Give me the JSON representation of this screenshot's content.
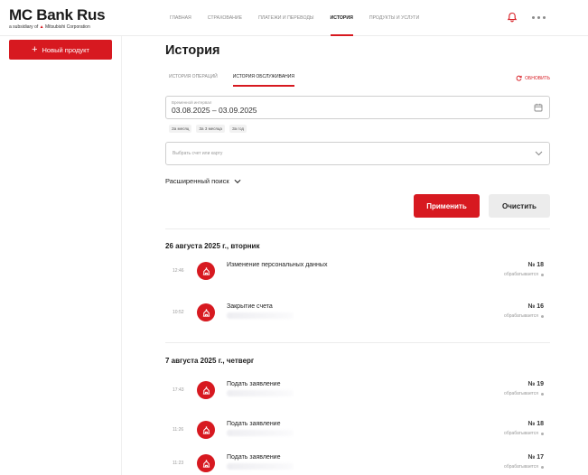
{
  "logo": {
    "title": "MC Bank Rus",
    "subtitle_prefix": "a subsidiary of",
    "subtitle_brand": "Mitsubishi Corporation"
  },
  "nav": [
    {
      "label": "Главная",
      "active": false
    },
    {
      "label": "Страхование",
      "active": false
    },
    {
      "label": "Платежи и переводы",
      "active": false
    },
    {
      "label": "История",
      "active": true
    },
    {
      "label": "Продукты и услуги",
      "active": false
    }
  ],
  "sidebar": {
    "new_product_label": "Новый продукт",
    "new_product_icon": "plus-icon"
  },
  "page": {
    "title": "История",
    "tabs": [
      {
        "label": "История операций",
        "active": false
      },
      {
        "label": "История обслуживания",
        "active": true
      }
    ],
    "refresh_label": "Обновить"
  },
  "filters": {
    "date_label": "Временной интервал",
    "date_value": "03.08.2025 – 03.09.2025",
    "quick_ranges": [
      "За месяц",
      "За 3 месяца",
      "За год"
    ],
    "account_placeholder": "Выбрать счет или карту",
    "advanced_search_label": "Расширенный поиск",
    "apply_label": "Применить",
    "clear_label": "Очистить"
  },
  "groups": [
    {
      "date": "26 августа 2025 г., вторник",
      "items": [
        {
          "time": "12:46",
          "title": "Изменение персональных данных",
          "number": "№ 18",
          "status": "обрабатывается"
        },
        {
          "time": "10:52",
          "title": "Закрытие счета",
          "number": "№ 16",
          "status": "обрабатывается"
        }
      ]
    },
    {
      "date": "7 августа 2025 г., четверг",
      "items": [
        {
          "time": "17:43",
          "title": "Подать заявление",
          "number": "№ 19",
          "status": "обрабатывается"
        },
        {
          "time": "11:26",
          "title": "Подать заявление",
          "number": "№ 18",
          "status": "обрабатывается"
        },
        {
          "time": "11:23",
          "title": "Подать заявление",
          "number": "№ 17",
          "status": "обрабатывается"
        }
      ]
    }
  ],
  "colors": {
    "accent": "#d71920",
    "secondary_button": "#ececec",
    "muted_text": "#9a9a9a"
  }
}
